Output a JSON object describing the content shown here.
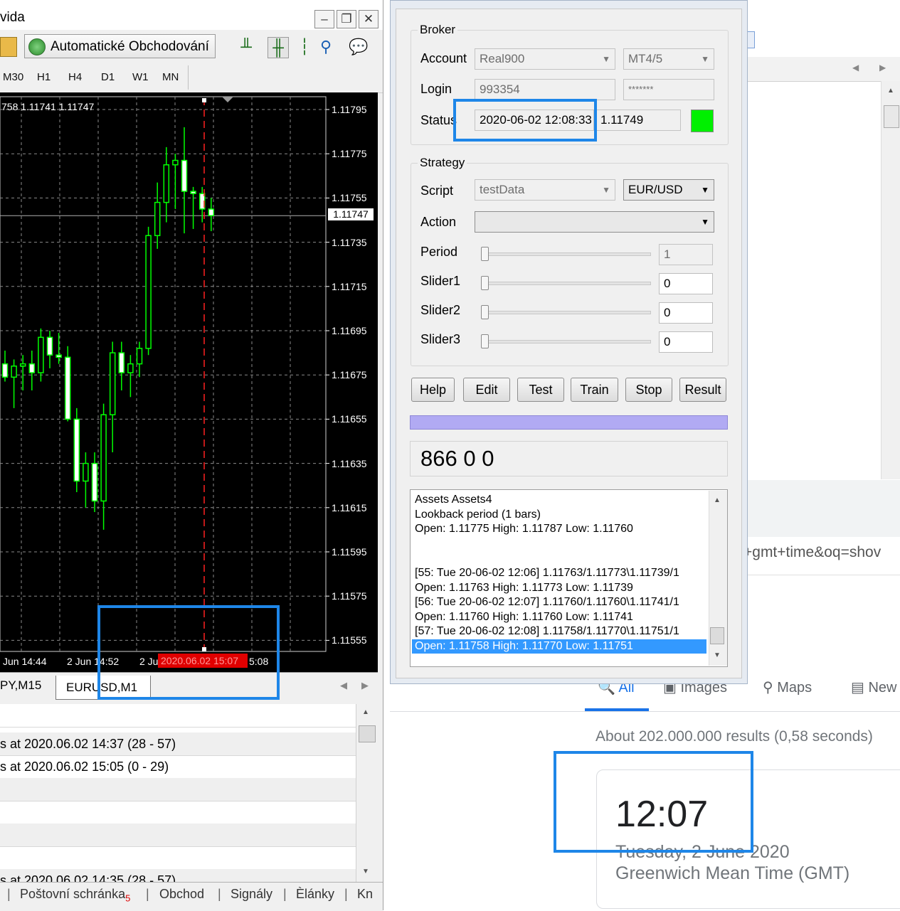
{
  "mt4": {
    "title_fragment": "vida",
    "auto_trading_label": "Automatické Obchodování",
    "timeframes": [
      "M30",
      "H1",
      "H4",
      "D1",
      "W1",
      "MN"
    ],
    "ohlc_label": "758 1.11741 1.11747",
    "price_ticks": [
      "1.11795",
      "1.11775",
      "1.11755",
      "1.11735",
      "1.11715",
      "1.11695",
      "1.11675",
      "1.11655",
      "1.11635",
      "1.11615",
      "1.11595",
      "1.11575",
      "1.11555"
    ],
    "current_price": "1.11747",
    "time_ticks": [
      "Jun 14:44",
      "2 Jun 14:52",
      "2 Ju",
      "5:08"
    ],
    "time_marker": "2020.06.02 15:07",
    "chart_tabs": [
      "PY,M15",
      "EURUSD,M1"
    ],
    "journal_rows": [
      "",
      "s at 2020.06.02 14:37 (28 - 57)",
      "s at 2020.06.02 15:05 (0 - 29)",
      "",
      "",
      "",
      "",
      "s at 2020.06.02 14:35 (28 - 57)"
    ],
    "bottom_tabs": [
      "Poštovní schránka",
      "Obchod",
      "Signály",
      "Èlánky",
      "Kn"
    ],
    "mail_badge": "5"
  },
  "zorro": {
    "broker": {
      "group_label": "Broker",
      "account_label": "Account",
      "account_value": "Real900",
      "account_type": "MT4/5",
      "login_label": "Login",
      "login_value": "993354",
      "password_value": "*******",
      "status_label": "Status",
      "status_time": "2020-06-02 12:08:33",
      "status_price": "1.11749",
      "status_color": "#00f000"
    },
    "strategy": {
      "group_label": "Strategy",
      "script_label": "Script",
      "script_value": "testData",
      "asset_value": "EUR/USD",
      "action_label": "Action",
      "action_value": "",
      "period_label": "Period",
      "period_value": "1",
      "sliders": [
        {
          "label": "Slider1",
          "value": "0"
        },
        {
          "label": "Slider2",
          "value": "0"
        },
        {
          "label": "Slider3",
          "value": "0"
        }
      ]
    },
    "buttons": [
      "Help",
      "Edit",
      "Test",
      "Train",
      "Stop",
      "Result"
    ],
    "readout": "866 0 0",
    "log_lines": [
      "Assets Assets4",
      "Lookback period (1 bars)",
      "Open: 1.11775 High: 1.11787 Low: 1.11760",
      "",
      "",
      "[55: Tue 20-06-02 12:06] 1.11763/1.11773\\1.11739/1",
      "Open: 1.11763 High: 1.11773 Low: 1.11739",
      "[56: Tue 20-06-02 12:07] 1.11760/1.11760\\1.11741/1",
      "Open: 1.11760 High: 1.11760 Low: 1.11741",
      "[57: Tue 20-06-02 12:08] 1.11758/1.11770\\1.11751/1",
      "Open: 1.11758 High: 1.11770 Low: 1.11751"
    ]
  },
  "browser": {
    "url_fragment": "+gmt+time&oq=shov",
    "tabs": [
      "All",
      "Images",
      "Maps",
      "New"
    ],
    "result_count": "About 202.000.000 results (0,58 seconds)",
    "time": "12:07",
    "date": "Tuesday, 2 June 2020",
    "zone": "Greenwich Mean Time (GMT)"
  },
  "colors": {
    "highlight": "#1e86e8",
    "candle": "#00ff00",
    "chart_bg": "#000000",
    "progress": "#b1aaf3",
    "log_selection": "#3399ff"
  },
  "candles": [
    {
      "o": 1.1168,
      "h": 1.11686,
      "l": 1.11672,
      "c": 1.11674
    },
    {
      "o": 1.11674,
      "h": 1.11682,
      "l": 1.1166,
      "c": 1.11679
    },
    {
      "o": 1.11679,
      "h": 1.11684,
      "l": 1.11668,
      "c": 1.1168
    },
    {
      "o": 1.1168,
      "h": 1.11686,
      "l": 1.11668,
      "c": 1.11676
    },
    {
      "o": 1.11676,
      "h": 1.11696,
      "l": 1.11672,
      "c": 1.11692
    },
    {
      "o": 1.11692,
      "h": 1.11695,
      "l": 1.11678,
      "c": 1.11684
    },
    {
      "o": 1.11684,
      "h": 1.11694,
      "l": 1.1168,
      "c": 1.11683
    },
    {
      "o": 1.11683,
      "h": 1.11688,
      "l": 1.11654,
      "c": 1.11655
    },
    {
      "o": 1.11655,
      "h": 1.1166,
      "l": 1.11622,
      "c": 1.11627
    },
    {
      "o": 1.11627,
      "h": 1.1164,
      "l": 1.11615,
      "c": 1.11635
    },
    {
      "o": 1.11635,
      "h": 1.1164,
      "l": 1.11613,
      "c": 1.11618
    },
    {
      "o": 1.11618,
      "h": 1.11662,
      "l": 1.11605,
      "c": 1.11657
    },
    {
      "o": 1.11657,
      "h": 1.1169,
      "l": 1.1164,
      "c": 1.11685
    },
    {
      "o": 1.11685,
      "h": 1.1169,
      "l": 1.11668,
      "c": 1.11676
    },
    {
      "o": 1.11676,
      "h": 1.11684,
      "l": 1.11665,
      "c": 1.1168
    },
    {
      "o": 1.1168,
      "h": 1.1169,
      "l": 1.11674,
      "c": 1.11687
    },
    {
      "o": 1.11687,
      "h": 1.11742,
      "l": 1.11684,
      "c": 1.11738
    },
    {
      "o": 1.11738,
      "h": 1.11762,
      "l": 1.11732,
      "c": 1.11753
    },
    {
      "o": 1.11753,
      "h": 1.11778,
      "l": 1.11744,
      "c": 1.1177
    },
    {
      "o": 1.1177,
      "h": 1.11775,
      "l": 1.1175,
      "c": 1.11772
    },
    {
      "o": 1.11772,
      "h": 1.11787,
      "l": 1.11739,
      "c": 1.11758
    },
    {
      "o": 1.11758,
      "h": 1.1176,
      "l": 1.11741,
      "c": 1.11757
    },
    {
      "o": 1.11757,
      "h": 1.1176,
      "l": 1.11744,
      "c": 1.1175
    },
    {
      "o": 1.1175,
      "h": 1.11755,
      "l": 1.1174,
      "c": 1.11747
    }
  ]
}
